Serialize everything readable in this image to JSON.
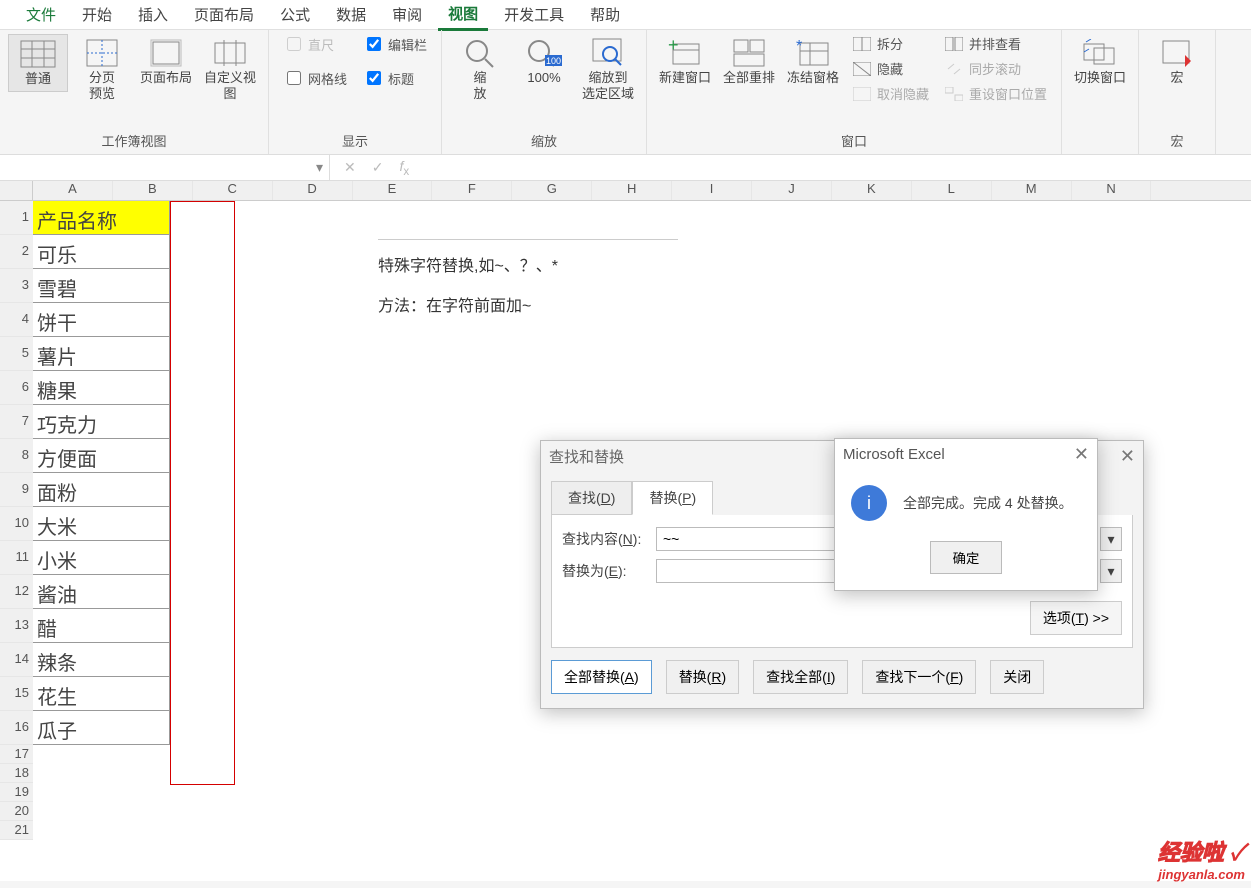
{
  "ribbon": {
    "tabs": [
      "文件",
      "开始",
      "插入",
      "页面布局",
      "公式",
      "数据",
      "审阅",
      "视图",
      "开发工具",
      "帮助"
    ],
    "activeTab": "视图",
    "view_group_label": "工作簿视图",
    "show_group_label": "显示",
    "zoom_group_label": "缩放",
    "window_group_label": "窗口",
    "macro_group_label": "宏",
    "btn_normal": "普通",
    "btn_pagebreak": "分页\n预览",
    "btn_pagelayout": "页面布局",
    "btn_customview": "自定义视图",
    "chk_ruler": "直尺",
    "chk_formula": "编辑栏",
    "chk_gridlines": "网格线",
    "chk_headings": "标题",
    "btn_zoom": "缩\n放",
    "btn_100": "100%",
    "btn_zoomtosel": "缩放到\n选定区域",
    "btn_newwin": "新建窗口",
    "btn_arrangeall": "全部重排",
    "btn_freeze": "冻结窗格",
    "btn_split": "拆分",
    "btn_hide": "隐藏",
    "btn_unhide": "取消隐藏",
    "btn_sidebyside": "并排查看",
    "btn_syncscroll": "同步滚动",
    "btn_resetpos": "重设窗口位置",
    "btn_switchwin": "切换窗口",
    "btn_macro": "宏"
  },
  "namebox": "",
  "columns": [
    "A",
    "B",
    "C",
    "D",
    "E",
    "F",
    "G",
    "H",
    "I",
    "J",
    "K",
    "L",
    "M",
    "N"
  ],
  "rows": [
    "1",
    "2",
    "3",
    "4",
    "5",
    "6",
    "7",
    "8",
    "9",
    "10",
    "11",
    "12",
    "13",
    "14",
    "15",
    "16",
    "17",
    "18",
    "19",
    "20",
    "21"
  ],
  "cellsA": [
    "产品名称",
    "可乐",
    "雪碧",
    "饼干",
    "薯片",
    "糖果",
    "巧克力",
    "方便面",
    "面粉",
    "大米",
    "小米",
    "酱油",
    "醋",
    "辣条",
    "花生",
    "瓜子"
  ],
  "textbox": {
    "line1": "特殊字符替换,如~、？、*",
    "line2": "方法：在字符前面加~"
  },
  "dialog": {
    "title": "查找和替换",
    "tab_find": "查找(D)",
    "tab_replace": "替换(P)",
    "find_label": "查找内容(N):",
    "replace_label": "替换为(E):",
    "find_value": "~~",
    "replace_value": "",
    "options": "选项(T) >>",
    "btn_replaceall": "全部替换(A)",
    "btn_replace": "替换(R)",
    "btn_findall": "查找全部(I)",
    "btn_findnext": "查找下一个(F)",
    "btn_close": "关闭"
  },
  "msgbox": {
    "title": "Microsoft Excel",
    "text": "全部完成。完成 4 处替换。",
    "ok": "确定"
  },
  "watermark": {
    "big": "经验啦",
    "site": "jingyanla.com"
  }
}
